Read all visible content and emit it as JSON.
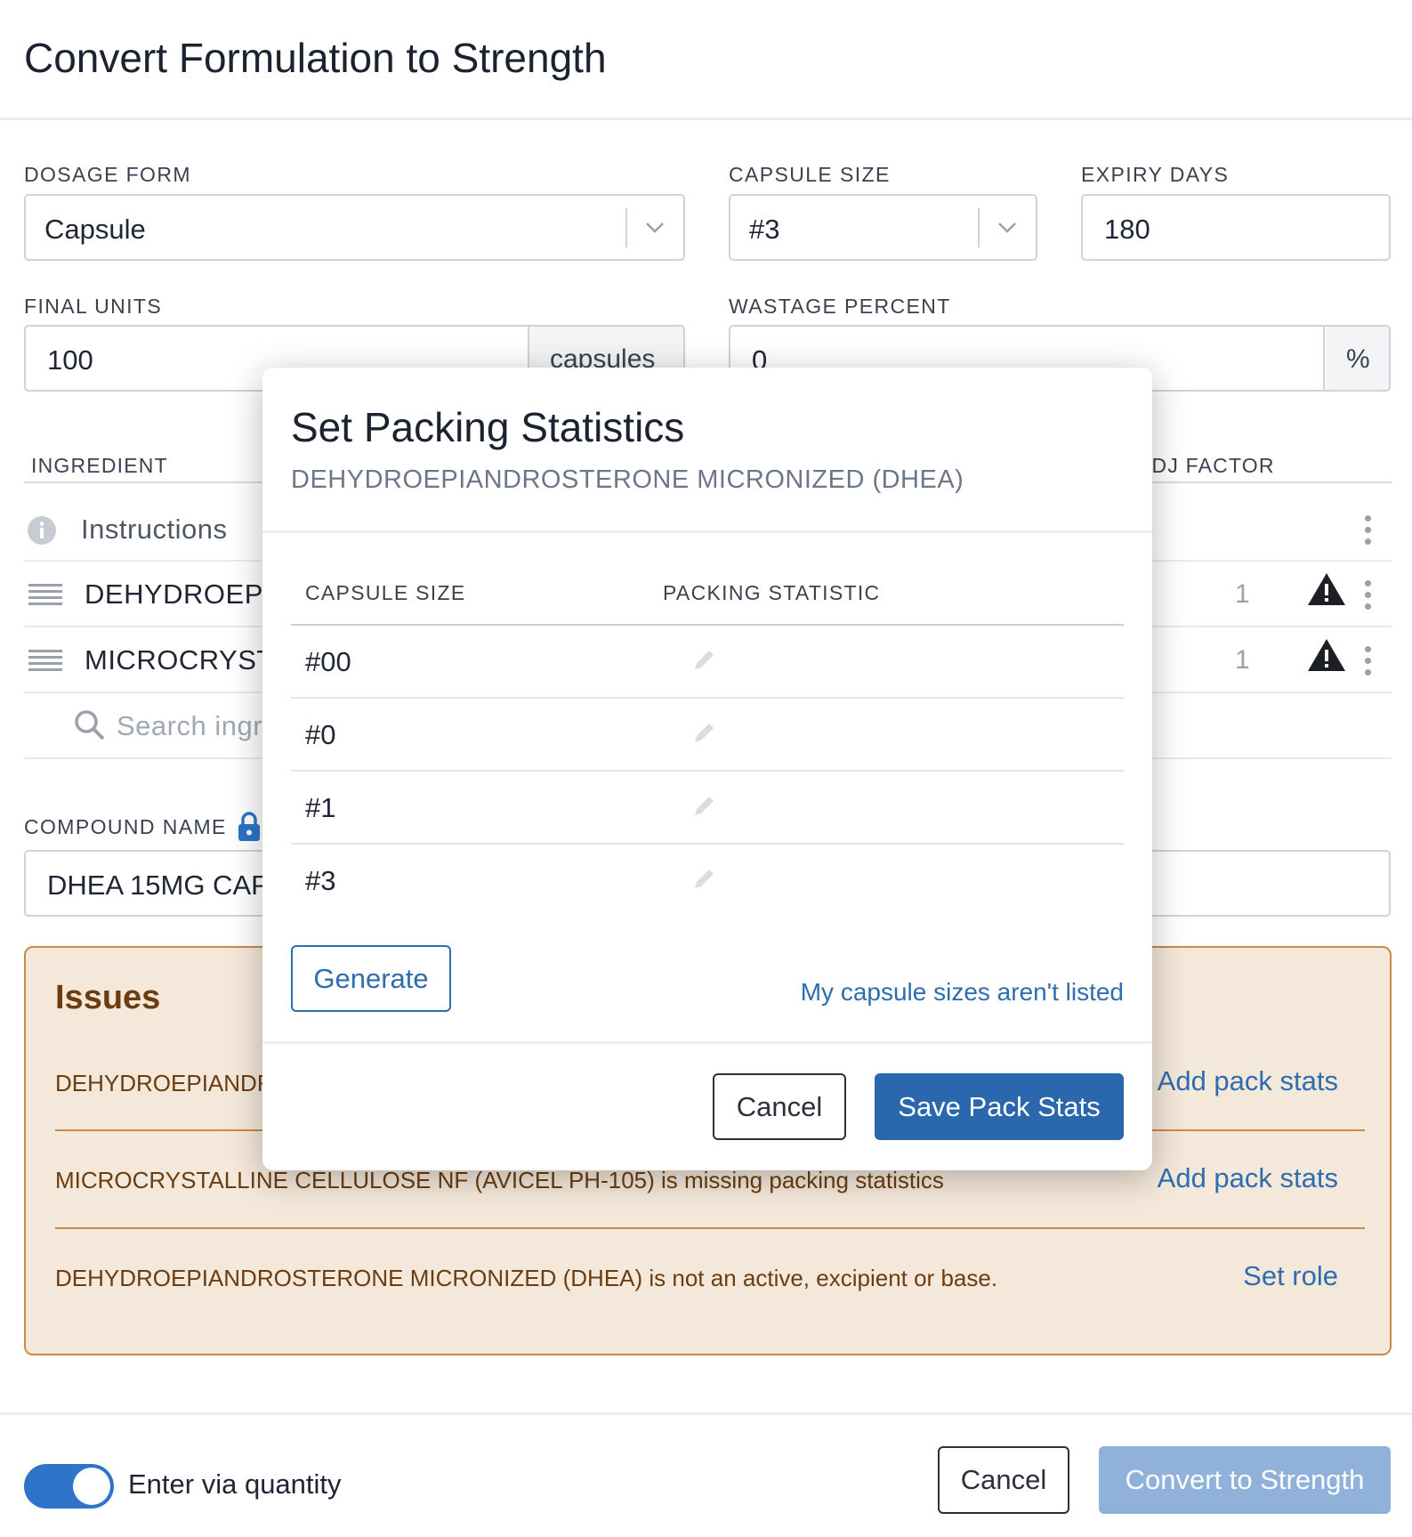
{
  "dialog": {
    "title": "Convert Formulation to Strength"
  },
  "form": {
    "dosage_form": {
      "label": "DOSAGE FORM",
      "value": "Capsule"
    },
    "capsule_size": {
      "label": "CAPSULE SIZE",
      "value": "#3"
    },
    "expiry_days": {
      "label": "EXPIRY DAYS",
      "value": "180"
    },
    "final_units": {
      "label": "FINAL UNITS",
      "value": "100",
      "unit": "capsules"
    },
    "wastage_percent": {
      "label": "WASTAGE PERCENT",
      "value": "0",
      "unit": "%"
    }
  },
  "ingredients": {
    "headers": {
      "ingredient": "INGREDIENT",
      "adj_factor": "ADJ FACTOR"
    },
    "instructions_label": "Instructions",
    "rows": [
      {
        "name": "DEHYDROEPIA",
        "adj_factor": "1"
      },
      {
        "name": "MICROCRYSTA",
        "adj_factor": "1"
      }
    ],
    "search_placeholder": "Search ingre"
  },
  "compound": {
    "label": "COMPOUND NAME",
    "value": "DHEA 15MG CAP"
  },
  "issues": {
    "title": "Issues",
    "items": [
      {
        "text": "DEHYDROEPIANDR",
        "action": "Add pack stats"
      },
      {
        "text": "MICROCRYSTALLINE CELLULOSE NF (AVICEL PH-105) is missing packing statistics",
        "action": "Add pack stats"
      },
      {
        "text": "DEHYDROEPIANDROSTERONE MICRONIZED (DHEA) is not an active, excipient or base.",
        "action": "Set role"
      }
    ]
  },
  "footer": {
    "toggle_label": "Enter via quantity",
    "toggle_on": true,
    "cancel_label": "Cancel",
    "convert_label": "Convert to Strength"
  },
  "modal": {
    "title": "Set Packing Statistics",
    "subtitle": "DEHYDROEPIANDROSTERONE MICRONIZED (DHEA)",
    "headers": {
      "capsule_size": "CAPSULE SIZE",
      "packing_statistic": "PACKING STATISTIC"
    },
    "rows": [
      {
        "size": "#00"
      },
      {
        "size": "#0"
      },
      {
        "size": "#1"
      },
      {
        "size": "#3"
      }
    ],
    "generate_label": "Generate",
    "missing_sizes_link": "My capsule sizes aren't listed",
    "cancel_label": "Cancel",
    "save_label": "Save Pack Stats"
  },
  "colors": {
    "primary": "#2b67ad",
    "link": "#2e6db0",
    "issues_bg": "#f4e8da",
    "issues_border": "#c98a44",
    "issues_text": "#6b3d10",
    "disabled_primary": "#8fb1da"
  }
}
